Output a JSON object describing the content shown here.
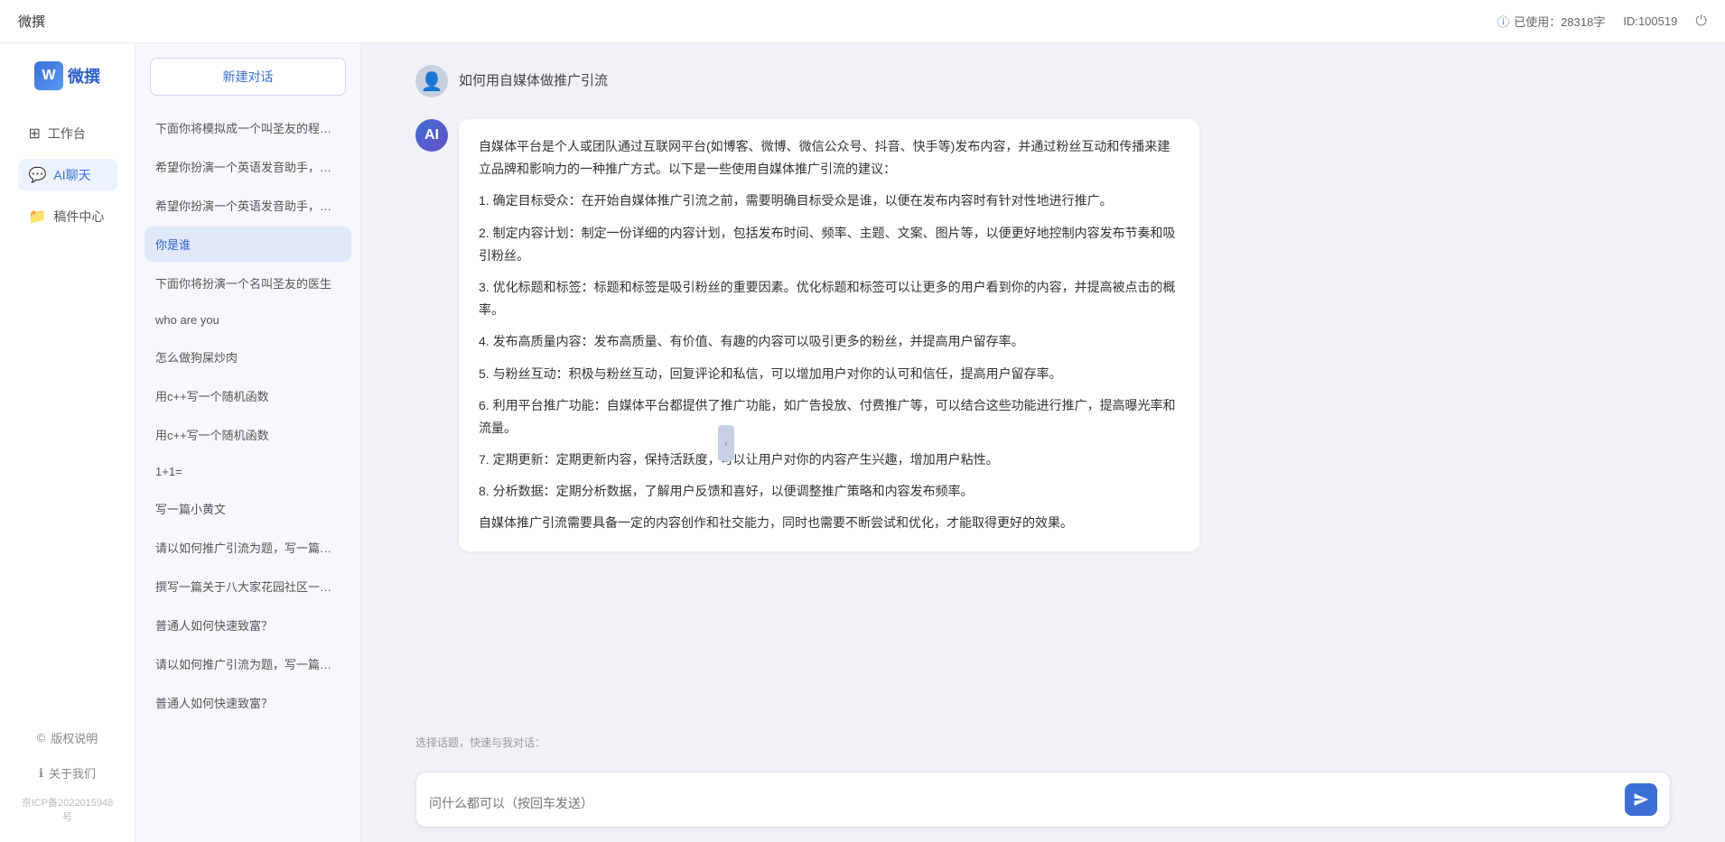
{
  "topbar": {
    "title": "微撰",
    "usage_label": "已使用：28318字",
    "info_icon": "ⓘ",
    "id_label": "ID:100519",
    "power_icon": "⏻"
  },
  "logo": {
    "w": "W",
    "text": "微撰"
  },
  "nav": {
    "items": [
      {
        "id": "workbench",
        "icon": "⊞",
        "label": "工作台"
      },
      {
        "id": "ai-chat",
        "icon": "💬",
        "label": "AI聊天",
        "active": true
      },
      {
        "id": "drafts",
        "icon": "📁",
        "label": "稿件中心"
      }
    ],
    "footer": [
      {
        "id": "copyright",
        "icon": "©",
        "label": "版权说明"
      },
      {
        "id": "about",
        "icon": "ℹ",
        "label": "关于我们"
      }
    ],
    "icp": "京ICP备2022015948号"
  },
  "conversations": {
    "new_btn": "新建对话",
    "items": [
      {
        "id": 1,
        "text": "下面你将模拟成一个叫圣友的程序员，我说..."
      },
      {
        "id": 2,
        "text": "希望你扮演一个英语发音助手，我提供给你..."
      },
      {
        "id": 3,
        "text": "希望你扮演一个英语发音助手，我提供给你..."
      },
      {
        "id": 4,
        "text": "你是谁",
        "active": true
      },
      {
        "id": 5,
        "text": "下面你将扮演一个名叫圣友的医生"
      },
      {
        "id": 6,
        "text": "who are you"
      },
      {
        "id": 7,
        "text": "怎么做狗屎炒肉"
      },
      {
        "id": 8,
        "text": "用c++写一个随机函数"
      },
      {
        "id": 9,
        "text": "用c++写一个随机函数"
      },
      {
        "id": 10,
        "text": "1+1="
      },
      {
        "id": 11,
        "text": "写一篇小黄文"
      },
      {
        "id": 12,
        "text": "请以如何推广引流为题，写一篇大纲"
      },
      {
        "id": 13,
        "text": "撰写一篇关于八大家花园社区一刻钟便民生..."
      },
      {
        "id": 14,
        "text": "普通人如何快速致富？"
      },
      {
        "id": 15,
        "text": "请以如何推广引流为题，写一篇大纲"
      },
      {
        "id": 16,
        "text": "普通人如何快速致富？"
      }
    ]
  },
  "chat": {
    "user_question": "如何用自媒体做推广引流",
    "ai_response": {
      "paragraphs": [
        "自媒体平台是个人或团队通过互联网平台(如博客、微博、微信公众号、抖音、快手等)发布内容，并通过粉丝互动和传播来建立品牌和影响力的一种推广方式。以下是一些使用自媒体推广引流的建议：",
        "1. 确定目标受众：在开始自媒体推广引流之前，需要明确目标受众是谁，以便在发布内容时有针对性地进行推广。",
        "2. 制定内容计划：制定一份详细的内容计划，包括发布时间、频率、主题、文案、图片等，以便更好地控制内容发布节奏和吸引粉丝。",
        "3. 优化标题和标签：标题和标签是吸引粉丝的重要因素。优化标题和标签可以让更多的用户看到你的内容，并提高被点击的概率。",
        "4. 发布高质量内容：发布高质量、有价值、有趣的内容可以吸引更多的粉丝，并提高用户留存率。",
        "5. 与粉丝互动：积极与粉丝互动，回复评论和私信，可以增加用户对你的认可和信任，提高用户留存率。",
        "6. 利用平台推广功能：自媒体平台都提供了推广功能，如广告投放、付费推广等，可以结合这些功能进行推广，提高曝光率和流量。",
        "7. 定期更新：定期更新内容，保持活跃度，可以让用户对你的内容产生兴趣，增加用户粘性。",
        "8. 分析数据：定期分析数据，了解用户反馈和喜好，以便调整推广策略和内容发布频率。",
        "自媒体推广引流需要具备一定的内容创作和社交能力，同时也需要不断尝试和优化，才能取得更好的效果。"
      ]
    },
    "quick_topics_label": "选择话题，快速与我对话：",
    "input_placeholder": "问什么都可以（按回车发送）",
    "send_icon": "send"
  }
}
